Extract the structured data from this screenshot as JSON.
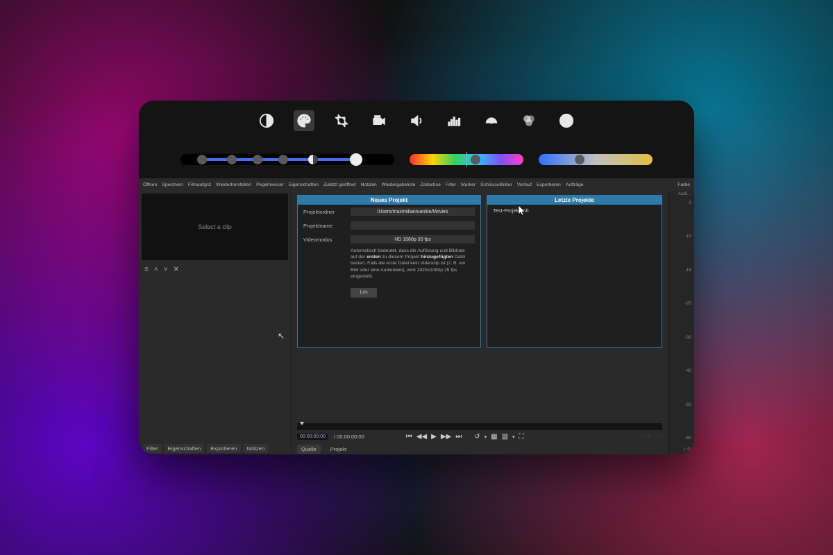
{
  "toolbar": {
    "icons": [
      "contrast",
      "palette",
      "crop",
      "camera",
      "volume",
      "equalizer",
      "speedometer",
      "color-wheels",
      "info"
    ],
    "active": "palette"
  },
  "sliders": {
    "multi_knobs": [
      10,
      24,
      36,
      48,
      62,
      82
    ],
    "tint_knob": 58,
    "temp_knob": 36
  },
  "menu": {
    "left": [
      "Öffnen",
      "Speichern",
      "Filmaufgriz",
      "Wiederherstellen",
      "Pegelmesser",
      "Eigenschaften",
      "Zuletzt geöffnet",
      "Notizen",
      "Wiedergabeliste",
      "Zeitachse",
      "Filter",
      "Marker",
      "Schlüsselbilder",
      "Verlauf",
      "Exportieren",
      "Aufträge"
    ],
    "right": "Farbe"
  },
  "left_panel": {
    "preview_text": "Select a clip",
    "icons": [
      "menu",
      "up",
      "down",
      "close"
    ],
    "tabs": [
      "Filter",
      "Eigenschaften",
      "Exportieren",
      "Notizen"
    ]
  },
  "new_project": {
    "title": "Neues Projekt",
    "folder_label": "Projektordner",
    "folder_value": "/Users/maximiliannuecke/Movies",
    "name_label": "Projektname",
    "name_value": "",
    "mode_label": "Videomodus",
    "mode_value": "HD 1080p 30 fps",
    "auto_text_1": "Automatisch bedeutet, dass die Auflösung und Bildrate auf der ",
    "auto_bold_1": "ersten",
    "auto_text_2": " zu diesem Projekt ",
    "auto_bold_2": "hinzugefügten",
    "auto_text_3": " Datei basiert. Falls die erste Datei kein Videoclip ist (z. B. ein Bild oder eine Audiodatei), wird 1920x1080p 25 fps eingestellt.",
    "start_btn": "Los"
  },
  "recent": {
    "title": "Letzte Projekte",
    "items": [
      "Test-Projekt.mlt"
    ]
  },
  "transport": {
    "tc_in": "00:00:00:00",
    "tc_total": "/ 00:00:00:00",
    "source_tabs": [
      "Quelle",
      "Projekt"
    ]
  },
  "audio_meter": {
    "header": "Audi…",
    "ticks": [
      "0",
      "-10",
      "-15",
      "-20",
      "-30",
      "-40",
      "-50",
      "-60"
    ],
    "label": "L  0"
  }
}
